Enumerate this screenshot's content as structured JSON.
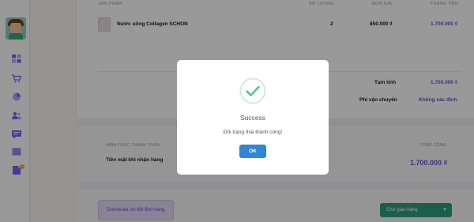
{
  "table": {
    "headers": {
      "product": "SẢN PHẨM",
      "quantity": "SỐ LƯỢNG",
      "unit_price": "ĐƠN GIÁ",
      "amount": "THÀNH TIỀN"
    },
    "rows": [
      {
        "name": "Nước uống Collagen SCHON",
        "quantity": "2",
        "unit_price": "850.000 ₫",
        "amount": "1.700.000 ₫"
      }
    ]
  },
  "summary": {
    "subtotal_label": "Tạm tính",
    "subtotal_value": "1.700.000 ₫",
    "shipping_label": "Phí vận chuyển",
    "shipping_value": "Không xác định"
  },
  "payment": {
    "method_header": "HÌNH THỨC THANH TOÁN",
    "method_value": "Tiền mặt khi nhận hàng",
    "total_header": "TỔNG CỘNG",
    "total_value": "1.700.000 ₫"
  },
  "actions": {
    "download_label": "Download chi tiết đơn hàng",
    "status_value": "Chờ giao hàng"
  },
  "modal": {
    "title": "Success",
    "message": "Đổi trạng thái thành công!",
    "ok_label": "OK"
  },
  "colors": {
    "accent": "#6a4fd1",
    "success": "#a5dc86",
    "ok_button": "#3085d6",
    "status_select": "#2c9e7f"
  },
  "icons": {
    "sidebar": [
      "dashboard-icon",
      "cart-icon",
      "chart-icon",
      "users-icon",
      "messages-icon",
      "list-icon",
      "documents-icon"
    ],
    "modal": "success-check-icon"
  }
}
